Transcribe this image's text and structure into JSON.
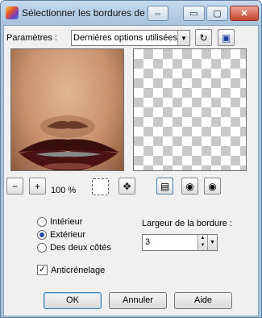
{
  "window": {
    "title": "Sélectionner les bordures de la",
    "nav_glyph": "⇔",
    "minimize_glyph": "▭",
    "restore_glyph": "▢",
    "close_glyph": "✕"
  },
  "params": {
    "label": "Paramètres :",
    "selected": "Dernières options utilisées",
    "arrow_glyph": "▼"
  },
  "preview": {
    "zoom_level": "100 %"
  },
  "icons": {
    "zoom_out": "−",
    "zoom_in": "+",
    "pan": "✥",
    "refresh": "↻",
    "save": "▣",
    "toggle_proof": "▤",
    "eye_lock": "◉",
    "eye": "◉"
  },
  "options": {
    "inside_label": "Intérieur",
    "outside_label": "Extérieur",
    "both_label": "Des deux côtés",
    "selected": "outside",
    "width_label": "Largeur de la bordure :",
    "width_value": "3",
    "spin_up": "▲",
    "spin_down": "▼",
    "antialias_label": "Anticrénelage",
    "antialias_checked": true,
    "check_glyph": "✓"
  },
  "buttons": {
    "ok": "OK",
    "cancel": "Annuler",
    "help": "Aide"
  }
}
